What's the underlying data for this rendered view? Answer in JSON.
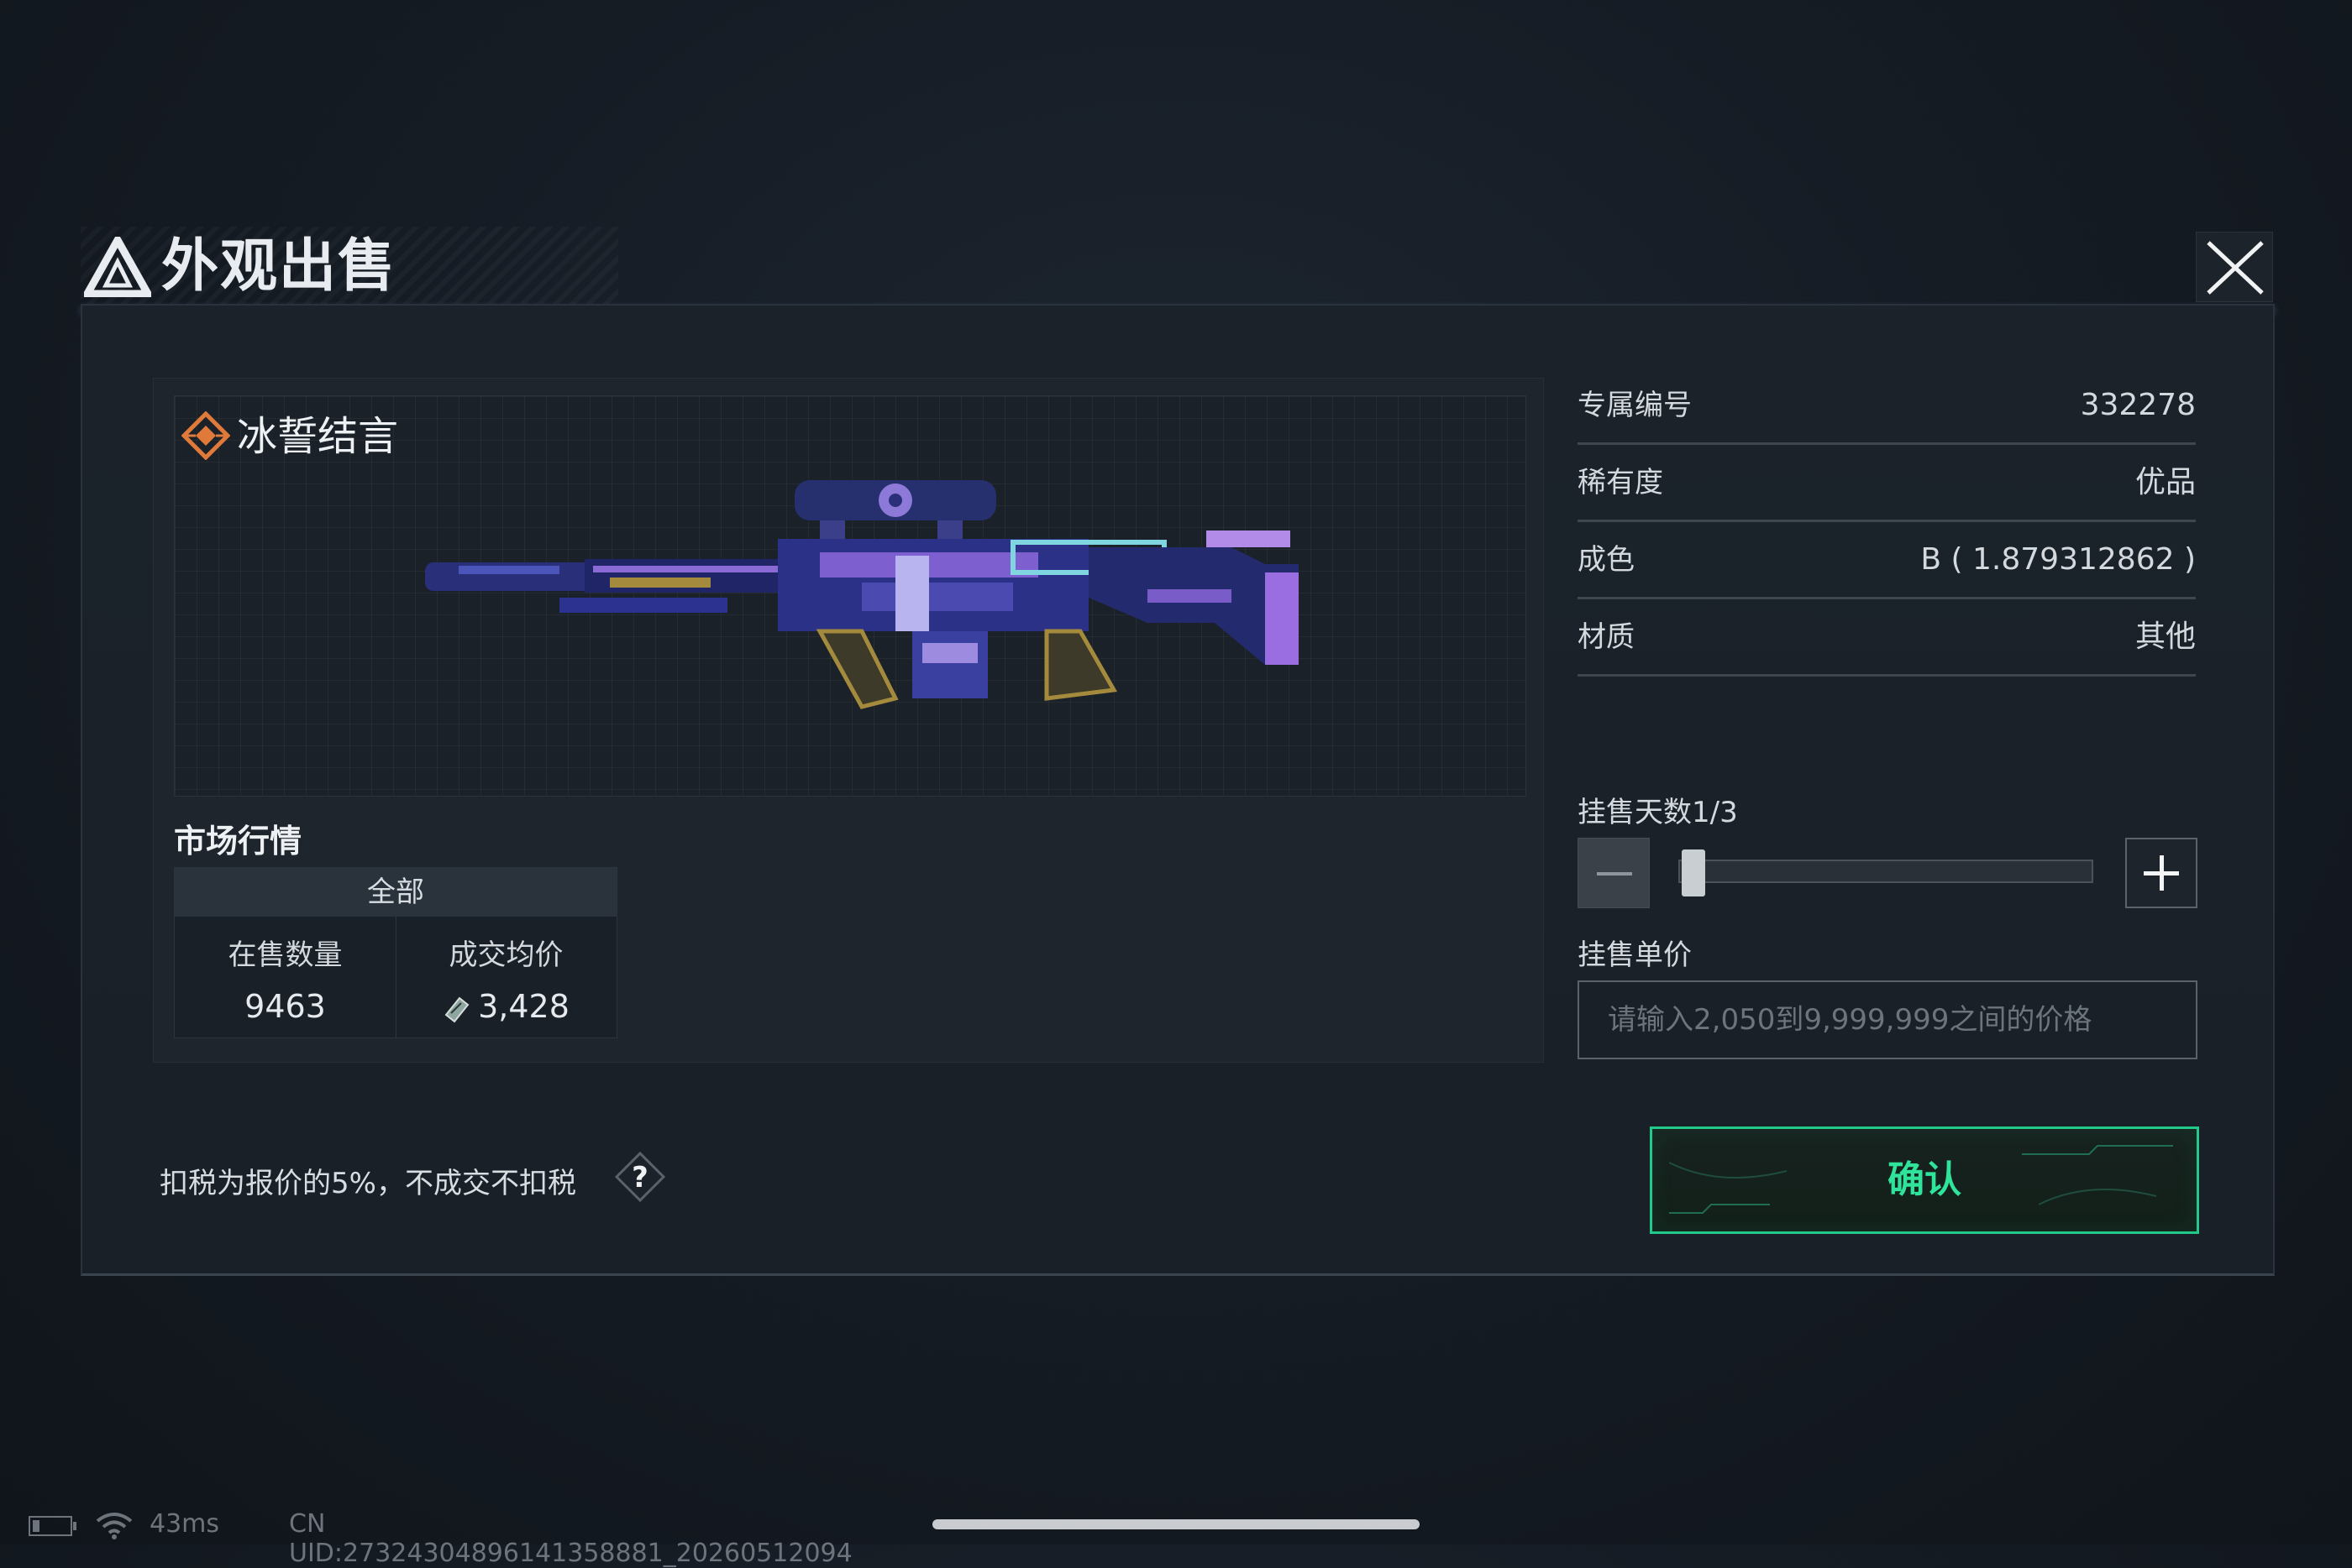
{
  "dialog": {
    "title": "外观出售",
    "close_icon": "close-icon"
  },
  "item": {
    "name": "冰誓结言",
    "rarity_icon": "rarity-diamond-icon",
    "image": "weapon-skin-image"
  },
  "market": {
    "title": "市场行情",
    "tab": "全部",
    "on_sale_label": "在售数量",
    "on_sale_value": "9463",
    "avg_price_label": "成交均价",
    "avg_price_value": "3,428",
    "currency_icon": "currency-icon"
  },
  "properties": [
    {
      "label": "专属编号",
      "value": "332278"
    },
    {
      "label": "稀有度",
      "value": "优品"
    },
    {
      "label": "成色",
      "value": "B ( 1.879312862 )"
    },
    {
      "label": "材质",
      "value": "其他"
    }
  ],
  "listing": {
    "days_label": "挂售天数1/3",
    "days_current": 1,
    "days_max": 3,
    "price_label": "挂售单价",
    "price_placeholder": "请输入2,050到9,999,999之间的价格",
    "price_value": ""
  },
  "tax_note": "扣税为报价的5%，不成交不扣税",
  "help_symbol": "?",
  "confirm_label": "确认",
  "status": {
    "ping": "43ms",
    "uid": "CN UID:27324304896141358881_20260512094"
  },
  "colors": {
    "accent": "#22c98a",
    "background": "#151b23",
    "rarity": "#e07a3a"
  }
}
